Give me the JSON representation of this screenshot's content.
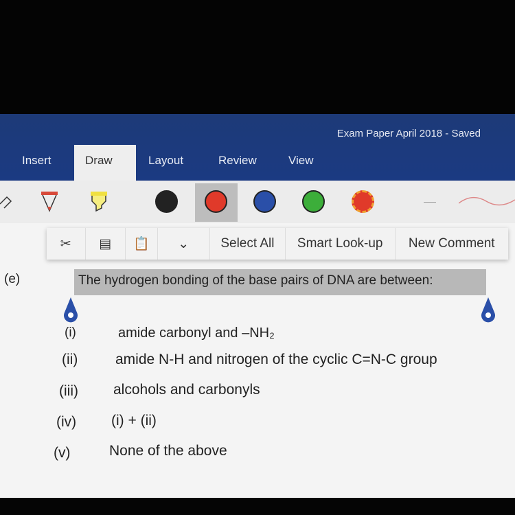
{
  "window": {
    "title": "Exam Paper April 2018 - Saved"
  },
  "tabs": [
    {
      "label": "Insert"
    },
    {
      "label": "Draw",
      "active": true
    },
    {
      "label": "Layout"
    },
    {
      "label": "Review"
    },
    {
      "label": "View"
    }
  ],
  "draw_tools": {
    "pens": [
      "pencil",
      "red-pen",
      "yellow-highlighter"
    ],
    "colors": [
      "#222222",
      "#e03a2a",
      "#2a4fa8",
      "#3cae3a"
    ],
    "selected_color": "#e03a2a"
  },
  "context_menu": {
    "icons": [
      "cut-icon",
      "copy-icon",
      "paste-icon",
      "chevron-down-icon"
    ],
    "items": [
      "Select All",
      "Smart Look-up",
      "New Comment"
    ]
  },
  "question": {
    "label": "(e)",
    "text": "The hydrogen bonding of the base pairs of DNA are between:",
    "options": [
      {
        "num": "(i)",
        "text": "amide carbonyl and –NH₂"
      },
      {
        "num": "(ii)",
        "text": "amide N-H and nitrogen of the cyclic C=N-C group"
      },
      {
        "num": "(iii)",
        "text": "alcohols and carbonyls"
      },
      {
        "num": "(iv)",
        "text": "(i) + (ii)"
      },
      {
        "num": "(v)",
        "text": "None of the above"
      }
    ]
  }
}
